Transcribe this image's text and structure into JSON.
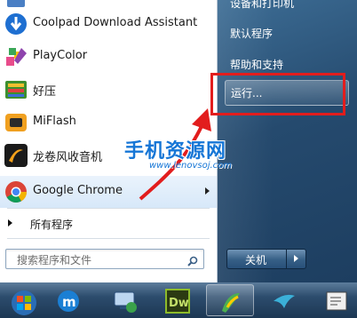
{
  "programs": [
    {
      "label": "Coolpad Download Assistant",
      "icon": "coolpad-download-icon"
    },
    {
      "label": "PlayColor",
      "icon": "playcolor-icon"
    },
    {
      "label": "好压",
      "icon": "haozip-icon"
    },
    {
      "label": "MiFlash",
      "icon": "miflash-icon"
    },
    {
      "label": "龙卷风收音机",
      "icon": "tornado-radio-icon"
    },
    {
      "label": "Google Chrome",
      "icon": "chrome-icon"
    }
  ],
  "all_programs_label": "所有程序",
  "search": {
    "placeholder": "搜索程序和文件"
  },
  "right_links": {
    "devices": "设备和打印机",
    "default_programs": "默认程序",
    "help": "帮助和支持",
    "run": "运行..."
  },
  "shutdown_label": "关机",
  "taskbar": [
    {
      "name": "start-orb-icon"
    },
    {
      "name": "app-m-icon"
    },
    {
      "name": "network-icon"
    },
    {
      "name": "dreamweaver-icon",
      "text": "Dw"
    },
    {
      "name": "app-parrot-icon"
    },
    {
      "name": "app-bird-icon"
    },
    {
      "name": "app-fx-icon"
    }
  ],
  "watermark": {
    "title": "手机资源网",
    "url": "www.lenovsoj.com"
  },
  "colors": {
    "highlight_box": "#e21d1d",
    "watermark": "#1676d6"
  }
}
